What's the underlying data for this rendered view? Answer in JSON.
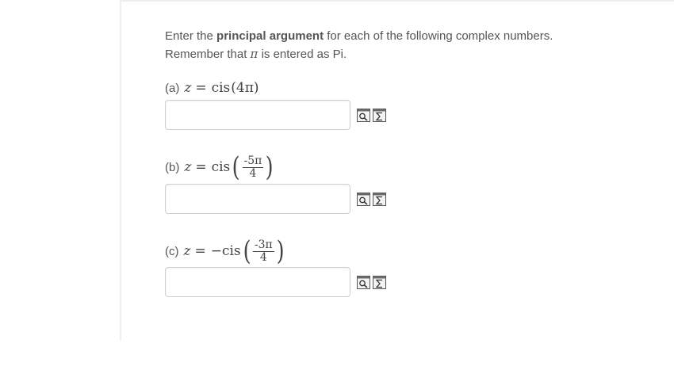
{
  "instructions": {
    "line1_prefix": "Enter the ",
    "line1_bold": "principal argument",
    "line1_suffix": " for each of the following complex numbers.",
    "line2_prefix": "Remember that ",
    "line2_symbol": "π",
    "line2_suffix": " is entered as Pi."
  },
  "parts": [
    {
      "label": "(a)",
      "variable": "z",
      "equals": "=",
      "function": "cis",
      "argument": "(4π)",
      "answer_value": "",
      "answer_placeholder": ""
    },
    {
      "label": "(b)",
      "variable": "z",
      "equals": "=",
      "function": "cis",
      "numerator": "-5π",
      "denominator": "4",
      "answer_value": "",
      "answer_placeholder": ""
    },
    {
      "label": "(c)",
      "variable": "z",
      "equals": "=",
      "sign": "−",
      "function": "cis",
      "numerator": "-3π",
      "denominator": "4",
      "answer_value": "",
      "answer_placeholder": ""
    }
  ],
  "icons": {
    "preview": "preview-answer-icon",
    "equation_editor": "equation-editor-icon"
  }
}
